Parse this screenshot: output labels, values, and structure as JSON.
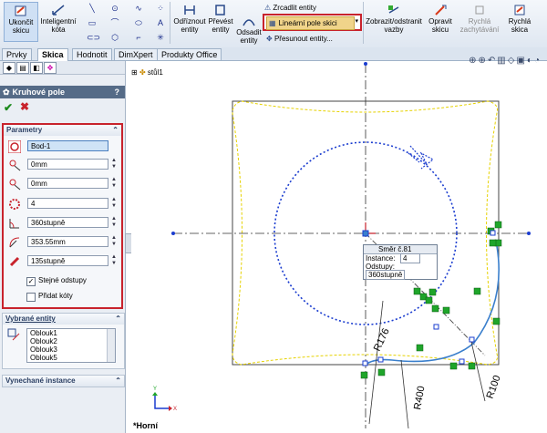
{
  "ribbon": {
    "exit_sketch": "Ukončit skicu",
    "smart_dimension": "Inteligentní kóta",
    "offset_entities": "Odříznout entity",
    "convert_entities": "Převést entity",
    "offset_entities2": "Odsadit entity",
    "mirror_entities": "Zrcadlit entity",
    "linear_pattern": "Lineární pole skici",
    "move_entities": "Přesunout entity...",
    "display_relations": "Zobrazit/odstranit vazby",
    "repair_sketch": "Opravit skicu",
    "rapid_snap": "Rychlá zachytávání",
    "rapid_sketch": "Rychlá skica"
  },
  "tabs": [
    "Prvky",
    "Skica",
    "Hodnotit",
    "DimXpert",
    "Produkty Office"
  ],
  "active_tab": "Skica",
  "tree": {
    "root": "stůl1"
  },
  "panel": {
    "title": "Kruhové pole",
    "params_header": "Parametry",
    "center_point": "Bod-1",
    "x_value": "0mm",
    "y_value": "0mm",
    "instances": "4",
    "angle": "360stupně",
    "radius": "353.55mm",
    "arc_angle": "135stupně",
    "equal_spacing": "Stejné odstupy",
    "equal_spacing_checked": true,
    "add_dims": "Přidat kóty",
    "add_dims_checked": false,
    "selected_header": "Vybrané entity",
    "selected_items": [
      "Oblouk1",
      "Oblouk2",
      "Oblouk3",
      "Oblouk5"
    ],
    "skipped_header": "Vynechané instance"
  },
  "tooltip": {
    "line1": "Směr č.81",
    "instance_label": "Instance:",
    "instance_value": "4",
    "spacing_label": "Odstupy:",
    "spacing_value": "360stupně"
  },
  "dims": {
    "r176": "R176",
    "r400": "R400",
    "r100": "R100"
  },
  "view_label": "*Horní",
  "colors": {
    "highlight": "#c8232c",
    "sketch_blue": "#1a3ccf",
    "yellow": "#e6d200",
    "green": "#1fa52a"
  }
}
